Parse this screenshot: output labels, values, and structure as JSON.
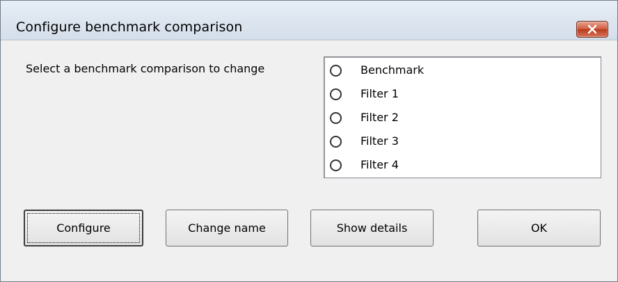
{
  "window": {
    "title": "Configure benchmark comparison",
    "close_icon": "close-x-icon"
  },
  "dialog": {
    "prompt": "Select a benchmark comparison to change",
    "options": [
      {
        "label": "Benchmark",
        "selected": false
      },
      {
        "label": "Filter 1",
        "selected": false
      },
      {
        "label": "Filter 2",
        "selected": false
      },
      {
        "label": "Filter 3",
        "selected": false
      },
      {
        "label": "Filter 4",
        "selected": false
      }
    ]
  },
  "buttons": {
    "configure": "Configure",
    "change_name": "Change name",
    "show_details": "Show details",
    "ok": "OK"
  },
  "colors": {
    "close_button": "#c7462a",
    "dialog_background": "#f0f0f0"
  }
}
